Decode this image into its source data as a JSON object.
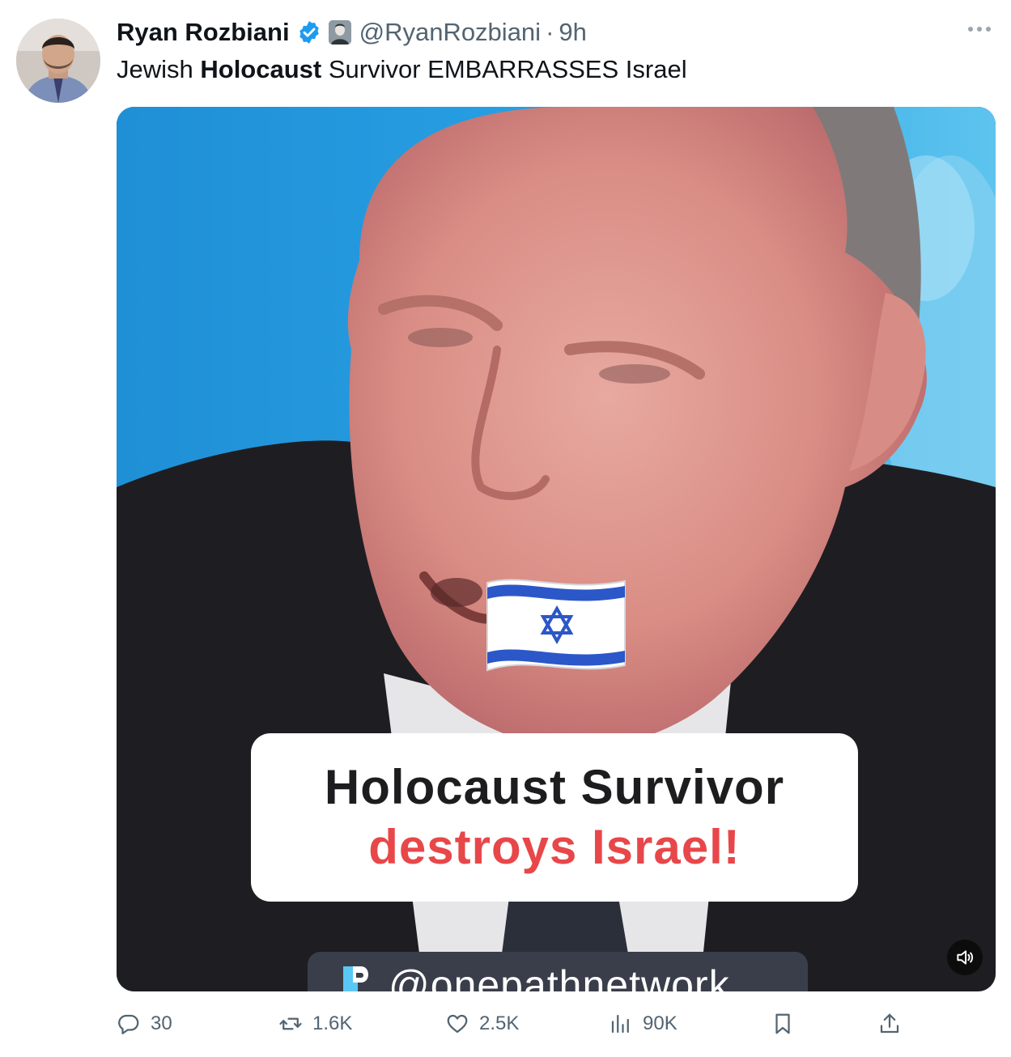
{
  "post": {
    "author": {
      "display_name": "Ryan Rozbiani",
      "handle": "@RyanRozbiani",
      "separator": "·",
      "time": "9h",
      "verified_color": "#1d9bf0"
    },
    "text": {
      "before": "Jewish ",
      "bold": "Holocaust",
      "after": " Survivor EMBARRASSES Israel"
    },
    "media": {
      "caption_line1": "Holocaust Survivor",
      "caption_line2": "destroys Israel!",
      "caption_line2_color": "#e8474a",
      "watermark": "@onepathnetwork",
      "flag_icon": "israel-flag-icon",
      "volume_icon": "speaker-icon"
    },
    "metrics": {
      "replies": "30",
      "reposts": "1.6K",
      "likes": "2.5K",
      "views": "90K"
    }
  }
}
